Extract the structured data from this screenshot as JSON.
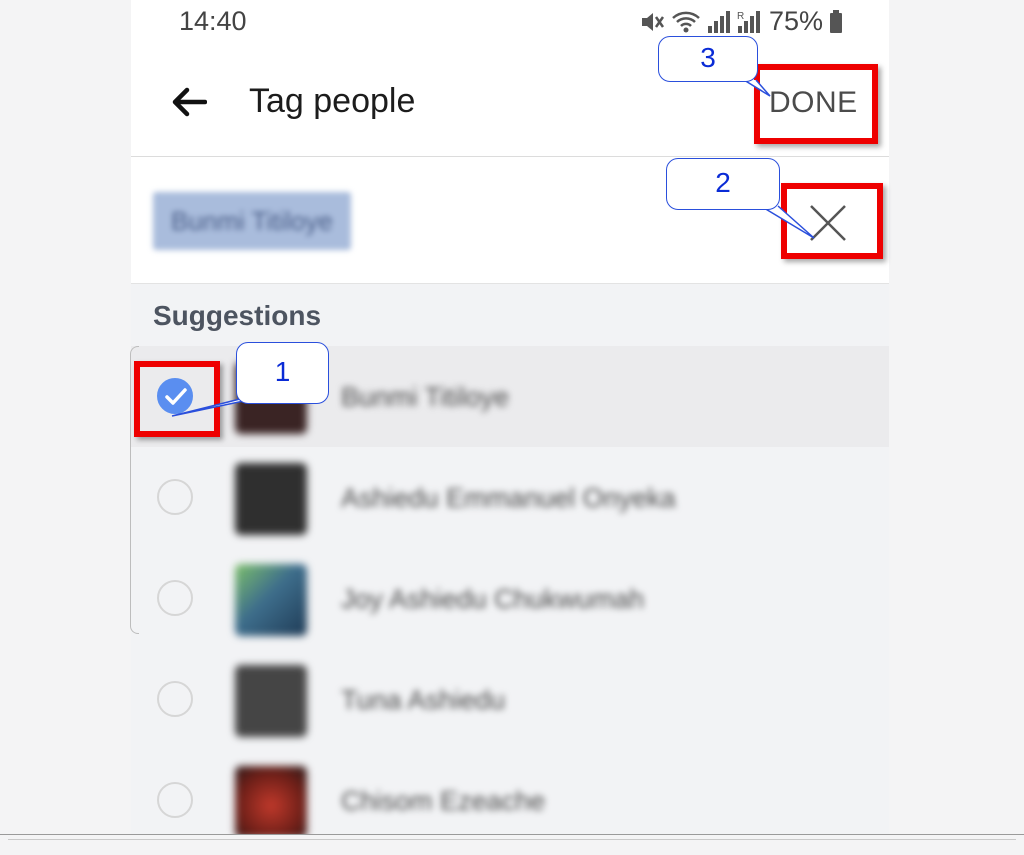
{
  "status_bar": {
    "time": "14:40",
    "battery": "75%"
  },
  "app_bar": {
    "title": "Tag people",
    "done_label": "DONE"
  },
  "search": {
    "chip_text": "Bunmi Titiloye"
  },
  "suggestions": {
    "header": "Suggestions",
    "items": [
      {
        "name": "Bunmi Titiloye",
        "selected": true,
        "avatar_color": "#3a2424"
      },
      {
        "name": "Ashiedu Emmanuel Onyeka",
        "selected": false,
        "avatar_color": "#2f2f2f"
      },
      {
        "name": "Joy Ashiedu Chukwumah",
        "selected": false,
        "avatar_color": "#3e6e8c"
      },
      {
        "name": "Tuna Ashiedu",
        "selected": false,
        "avatar_color": "#454545"
      },
      {
        "name": "Chisom Ezeache",
        "selected": false,
        "avatar_color": "#8a2a22"
      }
    ]
  },
  "annotations": [
    {
      "number": "1",
      "target": "checkbox"
    },
    {
      "number": "2",
      "target": "clear"
    },
    {
      "number": "3",
      "target": "done"
    }
  ],
  "colors": {
    "highlight": "#ee0000",
    "callout_text": "#0a2bd6",
    "check": "#5a8ef0"
  }
}
